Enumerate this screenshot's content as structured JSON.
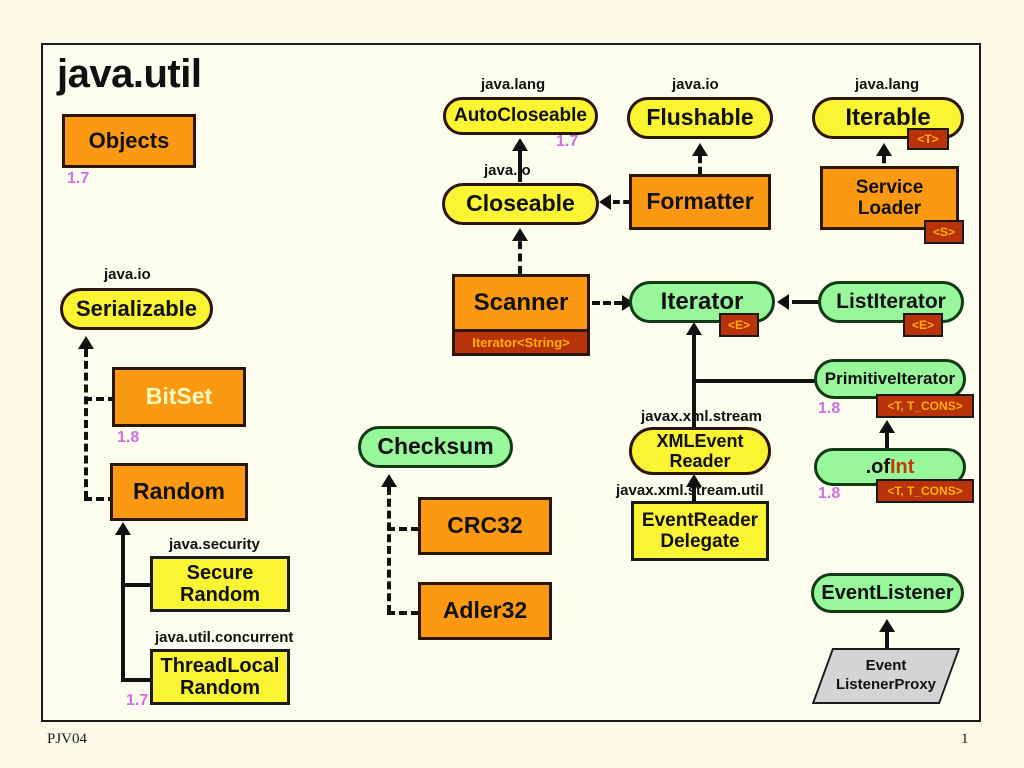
{
  "slide": {
    "title": "java.util",
    "footer_left": "PJV04",
    "footer_right": "1"
  },
  "palette": {
    "page_bg": "#fbfbe8",
    "frame_bg": "#fdfdef",
    "interface_yellow": "#fbf432",
    "interface_green": "#97f79a",
    "class_orange": "#fb9a12",
    "abstract_grey": "#d4d4d4",
    "generic_badge_bg": "#b8320a",
    "generic_badge_fg": "#ffb000",
    "version_label": "#d070e0",
    "outline": "#2b1606"
  },
  "nodes": {
    "objects": {
      "label": "Objects",
      "pkg": "",
      "version": "1.7",
      "kind": "class"
    },
    "auto_closeable": {
      "label": "AutoCloseable",
      "pkg": "java.lang",
      "version": "1.7",
      "kind": "interface"
    },
    "flushable": {
      "label": "Flushable",
      "pkg": "java.io",
      "version": "",
      "kind": "interface"
    },
    "iterable": {
      "label": "Iterable",
      "pkg": "java.lang",
      "version": "",
      "kind": "interface",
      "generic": "<T>"
    },
    "closeable": {
      "label": "Closeable",
      "pkg": "java.io",
      "version": "",
      "kind": "interface"
    },
    "formatter": {
      "label": "Formatter",
      "pkg": "",
      "version": "",
      "kind": "class"
    },
    "service_loader": {
      "line1": "Service",
      "line2": "Loader",
      "pkg": "",
      "version": "",
      "kind": "class",
      "generic": "<S>"
    },
    "serializable": {
      "label": "Serializable",
      "pkg": "java.io",
      "version": "",
      "kind": "interface"
    },
    "scanner": {
      "label": "Scanner",
      "pkg": "",
      "version": "",
      "kind": "class",
      "band": "Iterator<String>"
    },
    "iterator": {
      "label": "Iterator",
      "pkg": "",
      "version": "",
      "kind": "interface-green",
      "generic": "<E>"
    },
    "list_iterator": {
      "label": "ListIterator",
      "pkg": "",
      "version": "",
      "kind": "interface-green",
      "generic": "<E>"
    },
    "primitive_iterator": {
      "label": "PrimitiveIterator",
      "pkg": "",
      "version": "1.8",
      "kind": "interface-green",
      "generic": "<T, T_CONS>"
    },
    "of_int": {
      "label_plain": ".of",
      "label_accent": "Int",
      "pkg": "",
      "version": "1.8",
      "kind": "interface-green",
      "generic": "<T, T_CONS>"
    },
    "bitset": {
      "label": "BitSet",
      "pkg": "",
      "version": "1.8",
      "kind": "class"
    },
    "random": {
      "label": "Random",
      "pkg": "",
      "version": "",
      "kind": "class"
    },
    "secure_random": {
      "line1": "Secure",
      "line2": "Random",
      "pkg": "java.security",
      "version": "",
      "kind": "class-yellow"
    },
    "thread_local_random": {
      "line1": "ThreadLocal",
      "line2": "Random",
      "pkg": "java.util.concurrent",
      "version": "1.7",
      "kind": "class-yellow"
    },
    "checksum": {
      "label": "Checksum",
      "pkg": "",
      "version": "",
      "kind": "interface-green"
    },
    "crc32": {
      "label": "CRC32",
      "pkg": "",
      "version": "",
      "kind": "class"
    },
    "adler32": {
      "label": "Adler32",
      "pkg": "",
      "version": "",
      "kind": "class"
    },
    "xml_event_reader": {
      "line1": "XMLEvent",
      "line2": "Reader",
      "pkg": "javax.xml.stream",
      "version": "",
      "kind": "interface"
    },
    "event_reader_delegate": {
      "line1": "EventReader",
      "line2": "Delegate",
      "pkg": "javax.xml.stream.util",
      "version": "",
      "kind": "class-yellow"
    },
    "event_listener": {
      "label": "EventListener",
      "pkg": "",
      "version": "",
      "kind": "interface-green"
    },
    "event_listener_proxy": {
      "line1": "Event",
      "line2": "ListenerProxy",
      "pkg": "",
      "version": "",
      "kind": "abstract-class"
    }
  }
}
